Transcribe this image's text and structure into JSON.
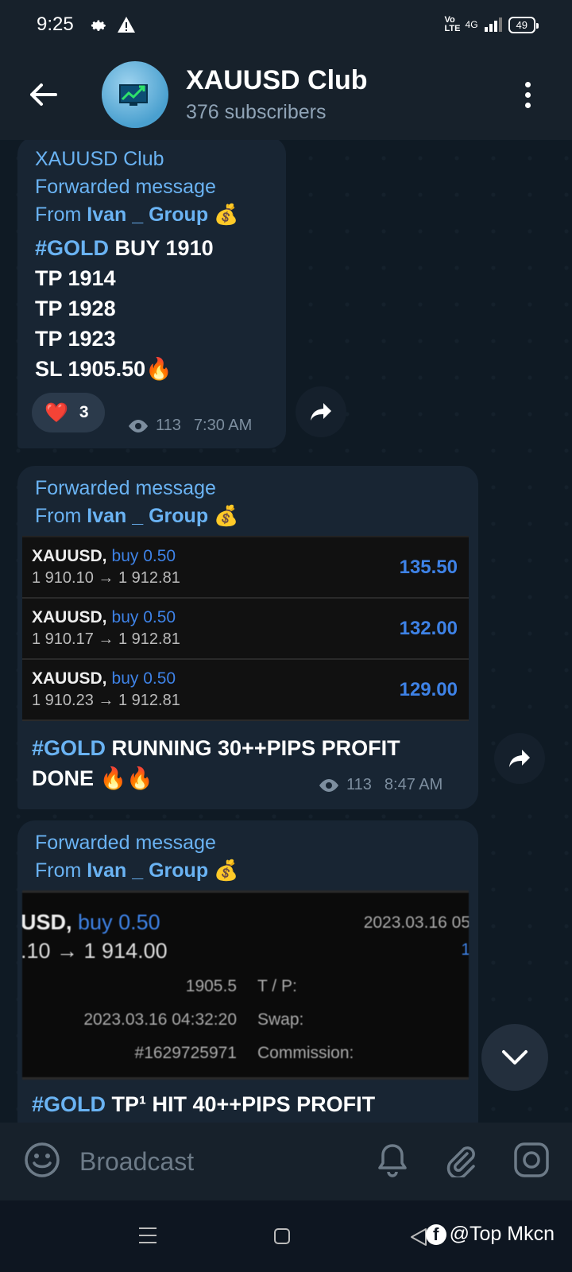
{
  "status_bar": {
    "time": "9:25",
    "net": "4G",
    "volte": "Vo LTE",
    "battery": "49"
  },
  "header": {
    "title": "XAUUSD Club",
    "subtitle": "376 subscribers"
  },
  "messages": [
    {
      "sender": "XAUUSD Club",
      "forwarded_label": "Forwarded message",
      "from_prefix": "From ",
      "from_name": "Ivan _ Group",
      "from_emoji": "💰",
      "tag": "#GOLD",
      "line1_rest": " BUY 1910",
      "line2": "TP 1914",
      "line3": "TP  1928",
      "line4": "TP  1923",
      "line5": "SL  1905.50🔥",
      "reaction_emoji": "❤️",
      "reaction_count": "3",
      "views": "113",
      "time": "7:30 AM"
    },
    {
      "forwarded_label": "Forwarded message",
      "from_prefix": "From ",
      "from_name": "Ivan _ Group",
      "from_emoji": "💰",
      "trades": [
        {
          "symbol": "XAUUSD,",
          "side": "buy 0.50",
          "prices": "1 910.10 → 1 912.81",
          "profit": "135.50"
        },
        {
          "symbol": "XAUUSD,",
          "side": "buy 0.50",
          "prices": "1 910.17 → 1 912.81",
          "profit": "132.00"
        },
        {
          "symbol": "XAUUSD,",
          "side": "buy 0.50",
          "prices": "1 910.23 → 1 912.81",
          "profit": "129.00"
        }
      ],
      "tag": "#GOLD",
      "text_rest": " RUNNING 30++PIPS PROFIT",
      "text_line2": "DONE 🔥🔥",
      "views": "113",
      "time": "8:47 AM"
    },
    {
      "forwarded_label": "Forwarded message",
      "from_prefix": "From ",
      "from_name": "Ivan _ Group",
      "from_emoji": "💰",
      "shot": {
        "symbol": "USD,",
        "side": "buy 0.50",
        "prices": ".10 → 1 914.00",
        "date": "2023.03.16 05",
        "right_digit": "1",
        "sl_value": "1905.5",
        "tp_label": "T / P:",
        "open_time": "2023.03.16 04:32:20",
        "swap_label": "Swap:",
        "ticket": "#1629725971",
        "commission_label": "Commission:"
      },
      "tag": "#GOLD",
      "text_rest": " TP¹ HIT 40++PIPS PROFIT"
    }
  ],
  "input": {
    "placeholder": "Broadcast"
  },
  "watermark": {
    "fb_letter": "f",
    "text": "@Top Mkcn"
  }
}
